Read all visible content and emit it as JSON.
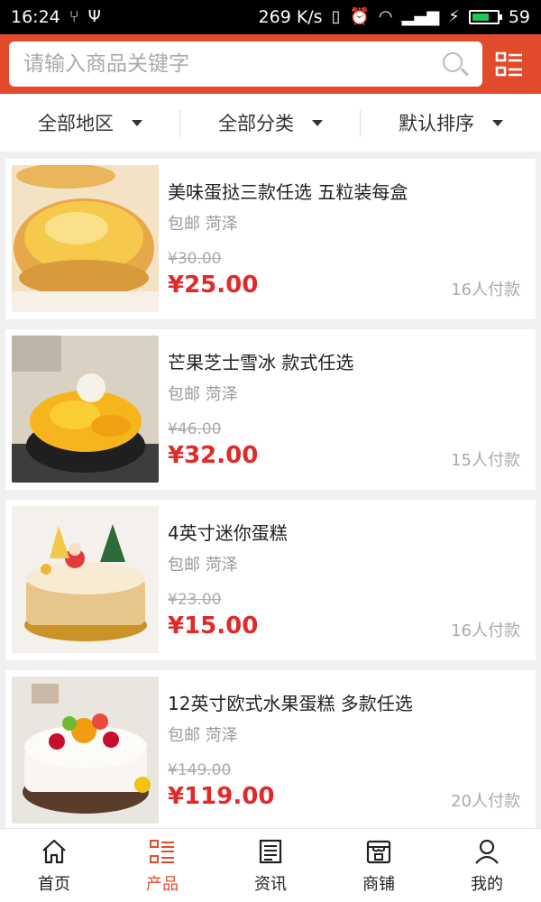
{
  "status_bar": {
    "time": "16:24",
    "network_speed": "269 K/s",
    "battery_level": "59"
  },
  "search": {
    "placeholder": "请输入商品关键字",
    "search_icon": "search-icon",
    "menu_icon": "list-menu-icon"
  },
  "filters": [
    {
      "label": "全部地区"
    },
    {
      "label": "全部分类"
    },
    {
      "label": "默认排序"
    }
  ],
  "products": [
    {
      "title": "美味蛋挞三款任选 五粒装每盒",
      "meta": "包邮 菏泽",
      "old_price": "¥30.00",
      "price": "¥25.00",
      "paid": "16人付款"
    },
    {
      "title": "芒果芝士雪冰 款式任选",
      "meta": "包邮 菏泽",
      "old_price": "¥46.00",
      "price": "¥32.00",
      "paid": "15人付款"
    },
    {
      "title": "4英寸迷你蛋糕",
      "meta": "包邮 菏泽",
      "old_price": "¥23.00",
      "price": "¥15.00",
      "paid": "16人付款"
    },
    {
      "title": "12英寸欧式水果蛋糕 多款任选",
      "meta": "包邮 菏泽",
      "old_price": "¥149.00",
      "price": "¥119.00",
      "paid": "20人付款"
    }
  ],
  "bottom_nav": [
    {
      "label": "首页",
      "icon": "home-icon"
    },
    {
      "label": "产品",
      "icon": "product-list-icon",
      "active": true
    },
    {
      "label": "资讯",
      "icon": "news-icon"
    },
    {
      "label": "商铺",
      "icon": "store-icon"
    },
    {
      "label": "我的",
      "icon": "user-icon"
    }
  ],
  "colors": {
    "brand": "#e24a2c",
    "price": "#e02a2a"
  }
}
